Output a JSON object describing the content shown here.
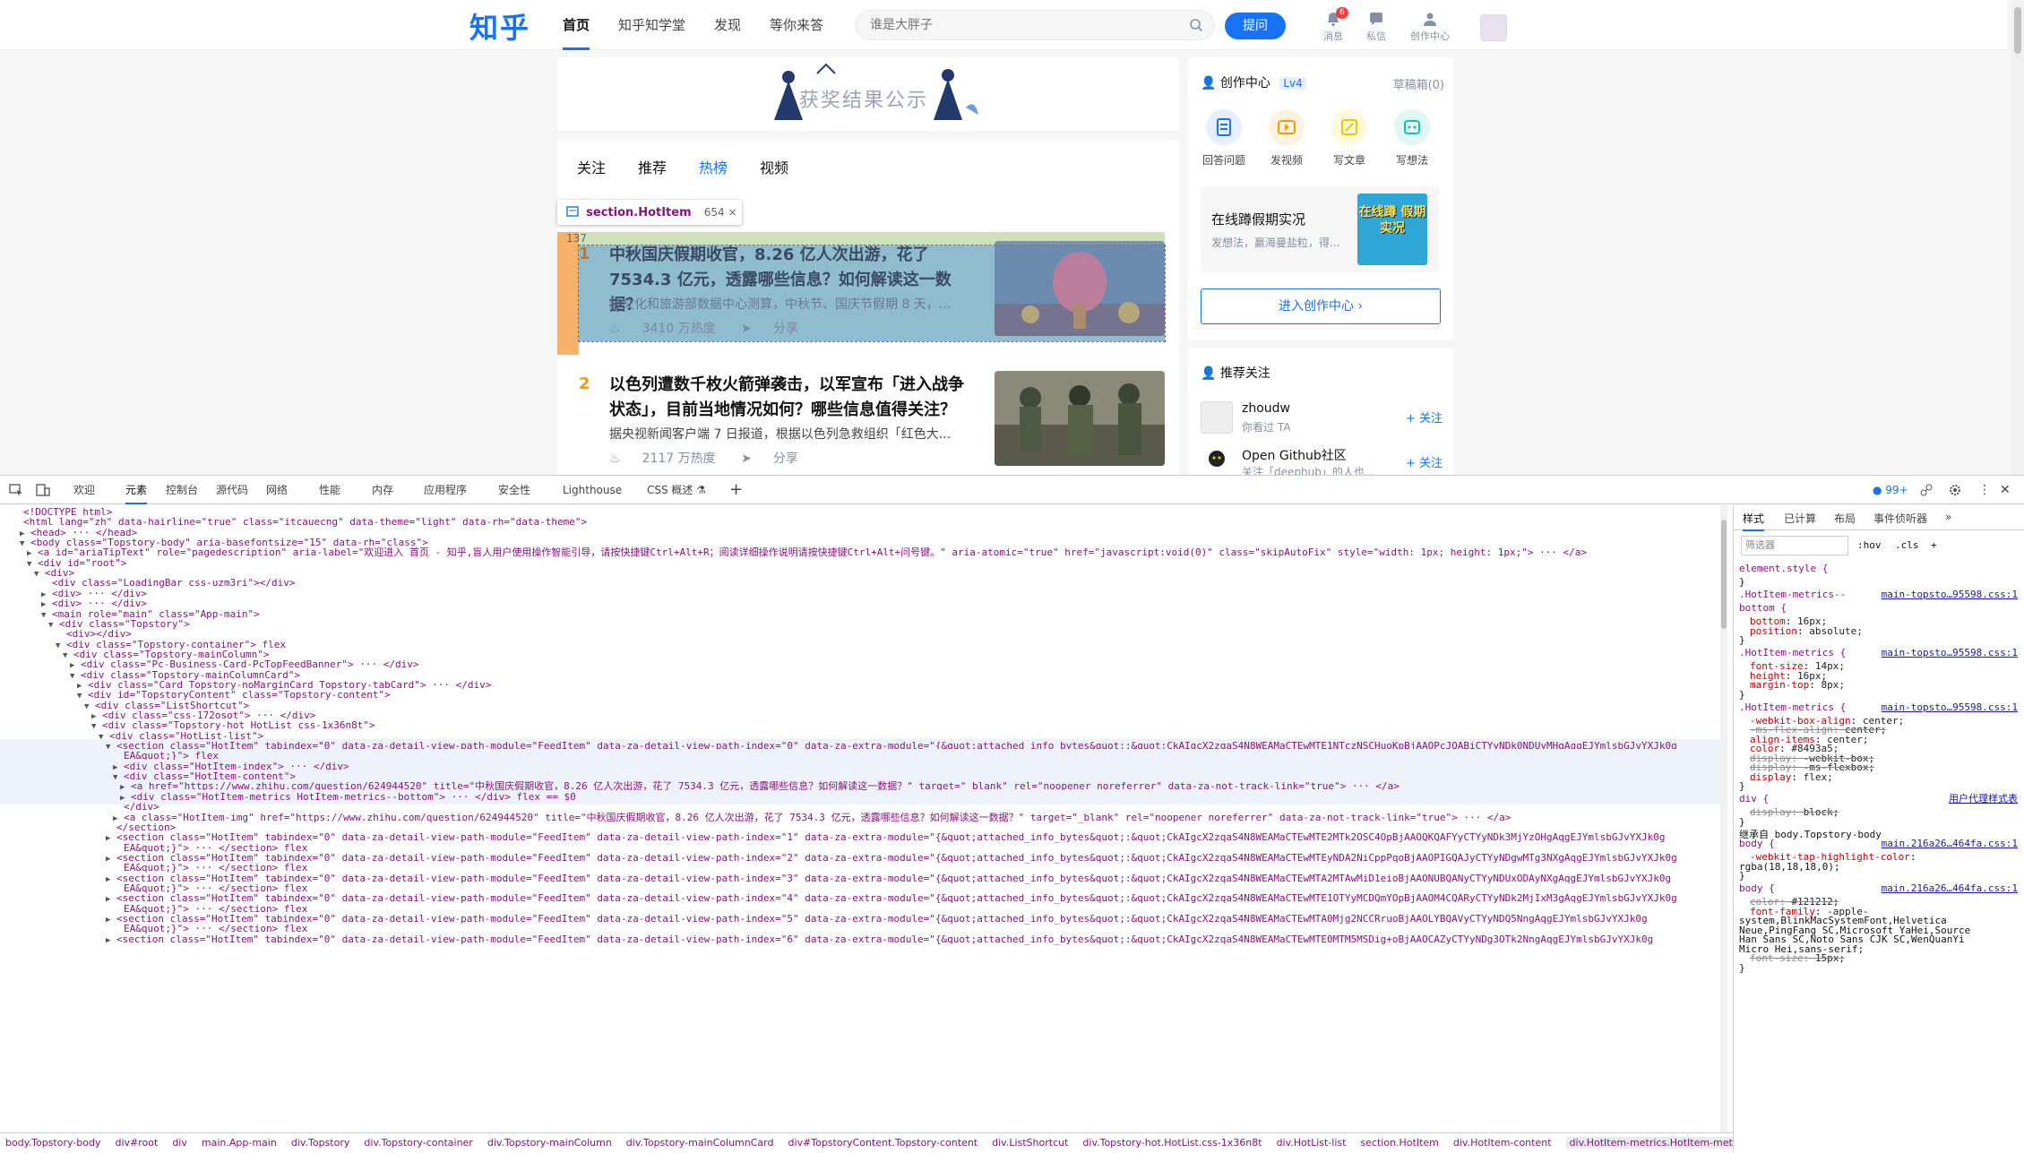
{
  "site": {
    "logo": "知乎",
    "nav": [
      "首页",
      "知乎知学堂",
      "发现",
      "等你来答"
    ],
    "search_placeholder": "谁是大胖子",
    "ask_label": "提问",
    "header_icons": [
      {
        "name": "bell-icon",
        "label": "消息",
        "badge": "6"
      },
      {
        "name": "chat-icon",
        "label": "私信"
      },
      {
        "name": "user-icon",
        "label": "创作中心"
      }
    ]
  },
  "banner": {
    "text": "获奖结果公示"
  },
  "feed": {
    "tabs": [
      "关注",
      "推荐",
      "热榜",
      "视频"
    ],
    "active_tab": "热榜",
    "tooltip": {
      "tag": "section.HotItem",
      "size": "654 × 137"
    },
    "items": [
      {
        "index": "1",
        "title": "中秋国庆假期收官，8.26 亿人次出游，花了 7534.3 亿元，透露哪些信息？如何解读这一数据？",
        "excerpt": "经文化和旅游部数据中心测算，中秋节、国庆节假期 8 天，...",
        "heat": "3410 万热度",
        "share": "分享"
      },
      {
        "index": "2",
        "title": "以色列遭数千枚火箭弹袭击，以军宣布「进入战争状态」，目前当地情况如何？哪些信息值得关注？",
        "excerpt": "据央视新闻客户端 7 日报道，根据以色列急救组织「红色大...",
        "heat": "2117 万热度",
        "share": "分享"
      }
    ]
  },
  "sidebar": {
    "creator_title": "创作中心",
    "level": "Lv4",
    "drafts": "草稿箱(0)",
    "actions": [
      {
        "label": "回答问题",
        "color": "#1772f6",
        "bg": "#e5efff",
        "icon": "doc-icon"
      },
      {
        "label": "发视频",
        "color": "#ff9607",
        "bg": "#fff3e0",
        "icon": "video-icon"
      },
      {
        "label": "写文章",
        "color": "#f5c400",
        "bg": "#fff9db",
        "icon": "pen-icon"
      },
      {
        "label": "写想法",
        "color": "#13c2b2",
        "bg": "#e0f7f4",
        "icon": "idea-icon"
      }
    ],
    "live_title": "在线蹲假期实况",
    "live_sub": "发想法，赢海曼盐粒，得...",
    "live_img_text": "在线蹲 假期实况",
    "enter_label": "进入创作中心 ›",
    "rec_title": "推荐关注",
    "recs": [
      {
        "name": "zhoudw",
        "desc": "你看过 TA",
        "follow": "+ 关注"
      },
      {
        "name": "Open Github社区",
        "desc": "关注「deephub」的人也...",
        "follow": "+ 关注"
      }
    ]
  },
  "devtools": {
    "tabs": [
      "欢迎",
      "元素",
      "控制台",
      "源代码",
      "网络",
      "性能",
      "内存",
      "应用程序",
      "安全性",
      "Lighthouse",
      "CSS 概述 ⚗"
    ],
    "active_tab": "元素",
    "issues": "99+",
    "dom_lines": [
      {
        "i": 0,
        "t": "",
        "h": "<!DOCTYPE html>"
      },
      {
        "i": 0,
        "t": "",
        "h": "<html lang=\"zh\" data-hairline=\"true\" class=\"itcauecng\" data-theme=\"light\" data-rh=\"data-theme\">"
      },
      {
        "i": 1,
        "t": "▶",
        "h": "<head> ··· </head>"
      },
      {
        "i": 1,
        "t": "▼",
        "h": "<body class=\"Topstory-body\" aria-basefontsize=\"15\" data-rh=\"class\">"
      },
      {
        "i": 2,
        "t": "▶",
        "h": "<a id=\"ariaTipText\" role=\"pagedescription\" aria-label=\"欢迎进入 首页 - 知乎,盲人用户使用操作智能引导，请按快捷键Ctrl+Alt+R；阅读详细操作说明请按快捷键Ctrl+Alt+问号键。\" aria-atomic=\"true\" href=\"javascript:void(0)\" class=\"skipAutoFix\" style=\"width: 1px; height: 1px;\"> ··· </a>"
      },
      {
        "i": 2,
        "t": "▼",
        "h": "<div id=\"root\">"
      },
      {
        "i": 3,
        "t": "▼",
        "h": "<div>"
      },
      {
        "i": 4,
        "t": "",
        "h": "<div class=\"LoadingBar  css-uzm3ri\"></div>"
      },
      {
        "i": 4,
        "t": "▶",
        "h": "<div> ··· </div>"
      },
      {
        "i": 4,
        "t": "▶",
        "h": "<div> ··· </div>"
      },
      {
        "i": 4,
        "t": "▼",
        "h": "<main role=\"main\" class=\"App-main\">"
      },
      {
        "i": 5,
        "t": "▼",
        "h": "<div class=\"Topstory\">"
      },
      {
        "i": 6,
        "t": "",
        "h": "<div></div>"
      },
      {
        "i": 6,
        "t": "▼",
        "h": "<div class=\"Topstory-container\"> flex"
      },
      {
        "i": 7,
        "t": "▼",
        "h": "<div class=\"Topstory-mainColumn\">"
      },
      {
        "i": 8,
        "t": "▶",
        "h": "<div class=\"Pc-Business-Card-PcTopFeedBanner\"> ··· </div>"
      },
      {
        "i": 8,
        "t": "▼",
        "h": "<div class=\"Topstory-mainColumnCard\">"
      },
      {
        "i": 9,
        "t": "▶",
        "h": "<div class=\"Card Topstory-noMarginCard Topstory-tabCard\"> ··· </div>"
      },
      {
        "i": 9,
        "t": "▼",
        "h": "<div id=\"TopstoryContent\" class=\"Topstory-content\">"
      },
      {
        "i": 10,
        "t": "▼",
        "h": "<div class=\"ListShortcut\">"
      },
      {
        "i": 11,
        "t": "▶",
        "h": "<div class=\"css-172osot\"> ··· </div>"
      },
      {
        "i": 11,
        "t": "▼",
        "h": "<div class=\"Topstory-hot HotList css-1x36n8t\">"
      },
      {
        "i": 12,
        "t": "▼",
        "h": "<div class=\"HotList-list\">"
      },
      {
        "i": 13,
        "t": "▼",
        "h": "<section class=\"HotItem\" tabindex=\"0\" data-za-detail-view-path-module=\"FeedItem\" data-za-detail-view-path-index=\"0\" data-za-extra-module=\"{&quot;attached_info_bytes&quot;:&quot;CkAIgcX2zqaS4N8WEAMaCTEwMTE1NTczNSCHuoKpBjAAOPcJQABiCTYyNDk0NDUyMHgAqgEJYmlsbGJvYXJk0g"
      },
      {
        "i": 14,
        "t": "",
        "h": "EA&quot;}\"> flex"
      },
      {
        "i": 14,
        "t": "▶",
        "h": "<div class=\"HotItem-index\"> ··· </div>"
      },
      {
        "i": 14,
        "t": "▼",
        "h": "<div class=\"HotItem-content\">"
      },
      {
        "i": 15,
        "t": "▶",
        "h": "<a href=\"https://www.zhihu.com/question/624944520\" title=\"中秋国庆假期收官，8.26 亿人次出游，花了 7534.3 亿元，透露哪些信息？如何解读这一数据？\" target=\"_blank\" rel=\"noopener noreferrer\" data-za-not-track-link=\"true\"> ··· </a>"
      },
      {
        "i": 15,
        "t": "▶",
        "h": "<div class=\"HotItem-metrics HotItem-metrics--bottom\"> ··· </div> flex  == $0"
      },
      {
        "i": 14,
        "t": "",
        "h": "</div>"
      },
      {
        "i": 14,
        "t": "▶",
        "h": "<a class=\"HotItem-img\" href=\"https://www.zhihu.com/question/624944520\" title=\"中秋国庆假期收官，8.26 亿人次出游，花了 7534.3 亿元，透露哪些信息？如何解读这一数据？\" target=\"_blank\" rel=\"noopener noreferrer\" data-za-not-track-link=\"true\"> ··· </a>"
      },
      {
        "i": 13,
        "t": "",
        "h": "</section>"
      },
      {
        "i": 13,
        "t": "▶",
        "h": "<section class=\"HotItem\" tabindex=\"0\" data-za-detail-view-path-module=\"FeedItem\" data-za-detail-view-path-index=\"1\" data-za-extra-module=\"{&quot;attached_info_bytes&quot;:&quot;CkAIgcX2zqaS4N8WEAMaCTEwMTE2MTk2OSC4OpBjAAOQKQAFYyCTYyNDk3MjYzOHgAqgEJYmlsbGJvYXJk0g"
      },
      {
        "i": 14,
        "t": "",
        "h": "EA&quot;}\"> ··· </section> flex"
      },
      {
        "i": 13,
        "t": "▶",
        "h": "<section class=\"HotItem\" tabindex=\"0\" data-za-detail-view-path-module=\"FeedItem\" data-za-detail-view-path-index=\"2\" data-za-extra-module=\"{&quot;attached_info_bytes&quot;:&quot;CkAIgcX2zqaS4N8WEAMaCTEwMTEyNDA2NiCppPqoBjAAOPIGQAJyCTYyNDgwMTg3NXgAqgEJYmlsbGJvYXJk0g"
      },
      {
        "i": 14,
        "t": "",
        "h": "EA&quot;}\"> ··· </section> flex"
      },
      {
        "i": 13,
        "t": "▶",
        "h": "<section class=\"HotItem\" tabindex=\"0\" data-za-detail-view-path-module=\"FeedItem\" data-za-detail-view-path-index=\"3\" data-za-extra-module=\"{&quot;attached_info_bytes&quot;:&quot;CkAIgcX2zqaS4N8WEAMaCTEwMTA2MTAwMiD1eioBjAAONUBQANyCTYyNDUxODAyNXgAqgEJYmlsbGJvYXJk0g"
      },
      {
        "i": 14,
        "t": "",
        "h": "EA&quot;}\"> ··· </section> flex"
      },
      {
        "i": 13,
        "t": "▶",
        "h": "<section class=\"HotItem\" tabindex=\"0\" data-za-detail-view-path-module=\"FeedItem\" data-za-detail-view-path-index=\"4\" data-za-extra-module=\"{&quot;attached_info_bytes&quot;:&quot;CkAIgcX2zqaS4N8WEAMaCTEwMTE1OTYyMCDQmYOpBjAAOM4CQARyCTYyNDk2MjIxM3gAqgEJYmlsbGJvYXJk0g"
      },
      {
        "i": 14,
        "t": "",
        "h": "EA&quot;}\"> ··· </section> flex"
      },
      {
        "i": 13,
        "t": "▶",
        "h": "<section class=\"HotItem\" tabindex=\"0\" data-za-detail-view-path-module=\"FeedItem\" data-za-detail-view-path-index=\"5\" data-za-extra-module=\"{&quot;attached_info_bytes&quot;:&quot;CkAIgcX2zqaS4N8WEAMaCTEwMTA0Mjg2NCCRruoBjAAOLYBQAVyCTYyNDQ5NngAqgEJYmlsbGJvYXJk0g"
      },
      {
        "i": 14,
        "t": "",
        "h": "EA&quot;}\"> ··· </section> flex"
      },
      {
        "i": 13,
        "t": "▶",
        "h": "<section class=\"HotItem\" tabindex=\"0\" data-za-detail-view-path-module=\"FeedItem\" data-za-detail-view-path-index=\"6\" data-za-extra-module=\"{&quot;attached_info_bytes&quot;:&quot;CkAIgcX2zqaS4N8WEAMaCTEwMTE0MTM5MSDig+oBjAAOCAZyCTYyNDg3OTk2NngAqgEJYmlsbGJvYXJk0g"
      }
    ],
    "styles_tabs": [
      "样式",
      "已计算",
      "布局",
      "事件侦听器",
      "»"
    ],
    "filter_placeholder": "筛选器",
    "filter_tools": [
      ":hov",
      ".cls",
      "+"
    ],
    "style_lines": [
      {
        "k": "sel",
        "v": "element.style {"
      },
      {
        "k": "plain",
        "v": "}"
      },
      {
        "k": "sel",
        "v": ".HotItem-metrics--",
        "src": "main-topsto…95598.css:1"
      },
      {
        "k": "sel",
        "v": "bottom {"
      },
      {
        "k": "prop",
        "p": "bottom",
        "val": "16px;"
      },
      {
        "k": "prop",
        "p": "position",
        "val": "absolute;"
      },
      {
        "k": "plain",
        "v": "}"
      },
      {
        "k": "sel",
        "v": ".HotItem-metrics {",
        "src": "main-topsto…95598.css:1"
      },
      {
        "k": "prop",
        "p": "font-size",
        "val": "14px;"
      },
      {
        "k": "prop",
        "p": "height",
        "val": "16px;"
      },
      {
        "k": "prop",
        "p": "margin-top",
        "val": "8px;"
      },
      {
        "k": "plain",
        "v": "}"
      },
      {
        "k": "sel",
        "v": ".HotItem-metrics {",
        "src": "main-topsto…95598.css:1"
      },
      {
        "k": "prop",
        "p": "-webkit-box-align",
        "val": "center;"
      },
      {
        "k": "strike",
        "p": "-ms-flex-align",
        "val": "center;"
      },
      {
        "k": "prop",
        "p": "align-items",
        "val": "center;"
      },
      {
        "k": "prop",
        "p": "color",
        "val": "#8493a5;"
      },
      {
        "k": "strike",
        "p": "display",
        "val": "-webkit-box;"
      },
      {
        "k": "strike",
        "p": "display",
        "val": "-ms-flexbox;"
      },
      {
        "k": "prop",
        "p": "display",
        "val": "flex;"
      },
      {
        "k": "plain",
        "v": "}"
      },
      {
        "k": "sel",
        "v": "div {",
        "src": "用户代理样式表"
      },
      {
        "k": "strike",
        "p": "display",
        "val": "block;"
      },
      {
        "k": "plain",
        "v": "}"
      },
      {
        "k": "plain",
        "v": "继承自 body.Topstory-body"
      },
      {
        "k": "sel",
        "v": "body {",
        "src": "main.216a26…464fa.css:1"
      },
      {
        "k": "prop",
        "p": "-webkit-tap-highlight-color",
        "val": ""
      },
      {
        "k": "plain",
        "v": "    rgba(18,18,18,0);"
      },
      {
        "k": "plain",
        "v": "}"
      },
      {
        "k": "sel",
        "v": "body {",
        "src": "main.216a26…464fa.css:1"
      },
      {
        "k": "strike",
        "p": "color",
        "val": "#121212;"
      },
      {
        "k": "prop",
        "p": "font-family",
        "val": "-apple-"
      },
      {
        "k": "plain",
        "v": "    system,BlinkMacSystemFont,Helvetica"
      },
      {
        "k": "plain",
        "v": "    Neue,PingFang SC,Microsoft YaHei,Source"
      },
      {
        "k": "plain",
        "v": "    Han Sans SC,Noto Sans CJK SC,WenQuanYi"
      },
      {
        "k": "plain",
        "v": "    Micro Hei,sans-serif;"
      },
      {
        "k": "strike",
        "p": "font-size",
        "val": "15px;"
      },
      {
        "k": "plain",
        "v": "}"
      }
    ],
    "breadcrumbs": [
      "body.Topstory-body",
      "div#root",
      "div",
      "main.App-main",
      "div.Topstory",
      "div.Topstory-container",
      "div.Topstory-mainColumn",
      "div.Topstory-mainColumnCard",
      "div#TopstoryContent.Topstory-content",
      "div.ListShortcut",
      "div.Topstory-hot.HotList.css-1x36n8t",
      "div.HotList-list",
      "section.HotItem",
      "div.HotItem-content",
      "div.HotItem-metrics.HotItem-metrics--bottom"
    ]
  }
}
